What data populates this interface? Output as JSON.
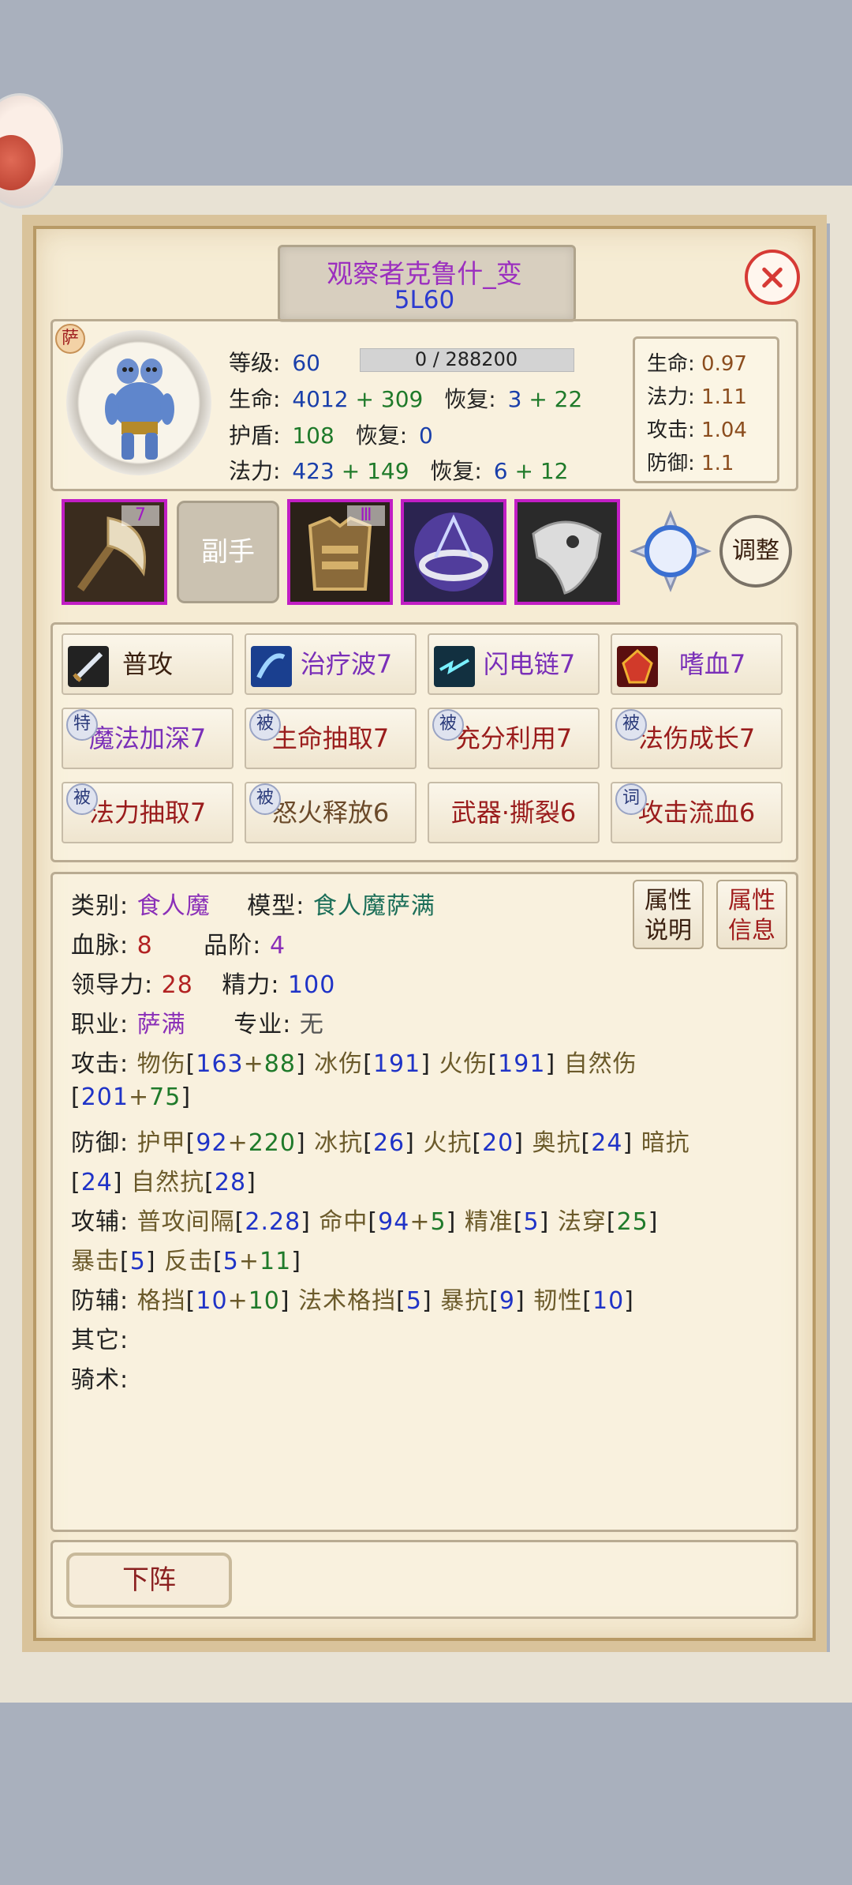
{
  "title": "观察者克鲁什_变",
  "subtitle": "5L60",
  "avatar_badge": "萨",
  "stats": {
    "level_label": "等级:",
    "level": "60",
    "exp_text": "0 / 288200",
    "exp_fraction": 0,
    "hp_label": "生命:",
    "hp_base": "4012",
    "hp_plus": "+ 309",
    "hp_regen_label": "恢复:",
    "hp_regen_base": "3",
    "hp_regen_plus": "+ 22",
    "shield_label": "护盾:",
    "shield": "108",
    "shield_regen_label": "恢复:",
    "shield_regen": "0",
    "mana_label": "法力:",
    "mana_base": "423",
    "mana_plus": "+ 149",
    "mana_regen_label": "恢复:",
    "mana_regen_base": "6",
    "mana_regen_plus": "+ 12"
  },
  "multipliers": [
    {
      "label": "生命:",
      "value": "0.97"
    },
    {
      "label": "法力:",
      "value": "1.11"
    },
    {
      "label": "攻击:",
      "value": "1.04"
    },
    {
      "label": "防御:",
      "value": "1.1"
    }
  ],
  "equipment": {
    "slot1_num": "7",
    "offhand_label": "副手",
    "slot3_num": "Ⅲ",
    "adjust_label": "调整"
  },
  "skills": [
    {
      "label": "普攻",
      "badge": ""
    },
    {
      "label": "治疗波7",
      "badge": ""
    },
    {
      "label": "闪电链7",
      "badge": ""
    },
    {
      "label": "嗜血7",
      "badge": ""
    },
    {
      "label": "魔法加深7",
      "badge": "特"
    },
    {
      "label": "生命抽取7",
      "badge": "被"
    },
    {
      "label": "充分利用7",
      "badge": "被"
    },
    {
      "label": "法伤成长7",
      "badge": "被"
    },
    {
      "label": "法力抽取7",
      "badge": "被"
    },
    {
      "label": "怒火释放6",
      "badge": "被"
    },
    {
      "label": "武器·撕裂6",
      "badge": ""
    },
    {
      "label": "攻击流血6",
      "badge": "词"
    }
  ],
  "attr_buttons": {
    "desc": [
      "属性",
      "说明"
    ],
    "info": [
      "属性",
      "信息"
    ]
  },
  "attrs": {
    "category_label": "类别:",
    "category": "食人魔",
    "model_label": "模型:",
    "model": "食人魔萨满",
    "bloodline_label": "血脉:",
    "bloodline": "8",
    "grade_label": "品阶:",
    "grade": "4",
    "leadership_label": "领导力:",
    "leadership": "28",
    "energy_label": "精力:",
    "energy": "100",
    "class_label": "职业:",
    "class": "萨满",
    "specialty_label": "专业:",
    "specialty": "无",
    "attack_label": "攻击:",
    "phys_dmg_label": "物伤",
    "phys_dmg_a": "163",
    "phys_dmg_b": "88",
    "ice_dmg_label": "冰伤",
    "ice_dmg": "191",
    "fire_dmg_label": "火伤",
    "fire_dmg": "191",
    "nature_dmg_label": "自然伤",
    "nature_dmg_a": "201",
    "nature_dmg_b": "75",
    "defense_label": "防御:",
    "armor_label": "护甲",
    "armor_a": "92",
    "armor_b": "220",
    "ice_res_label": "冰抗",
    "ice_res": "26",
    "fire_res_label": "火抗",
    "fire_res": "20",
    "arcane_res_label": "奥抗",
    "arcane_res": "24",
    "dark_res_label": "暗抗",
    "dark_res": "24",
    "nature_res_label": "自然抗",
    "nature_res": "28",
    "atk_aux_label": "攻辅:",
    "atk_interval_label": "普攻间隔",
    "atk_interval": "2.28",
    "hit_label": "命中",
    "hit_a": "94",
    "hit_b": "5",
    "precision_label": "精准",
    "precision": "5",
    "spell_pen_label": "法穿",
    "spell_pen": "25",
    "crit_label": "暴击",
    "crit": "5",
    "counter_label": "反击",
    "counter_a": "5",
    "counter_b": "11",
    "def_aux_label": "防辅:",
    "block_label": "格挡",
    "block_a": "10",
    "block_b": "10",
    "spell_block_label": "法术格挡",
    "spell_block": "5",
    "crit_res_label": "暴抗",
    "crit_res": "9",
    "tenacity_label": "韧性",
    "tenacity": "10",
    "other_label": "其它:",
    "riding_label": "骑术:"
  },
  "deploy_label": "下阵"
}
